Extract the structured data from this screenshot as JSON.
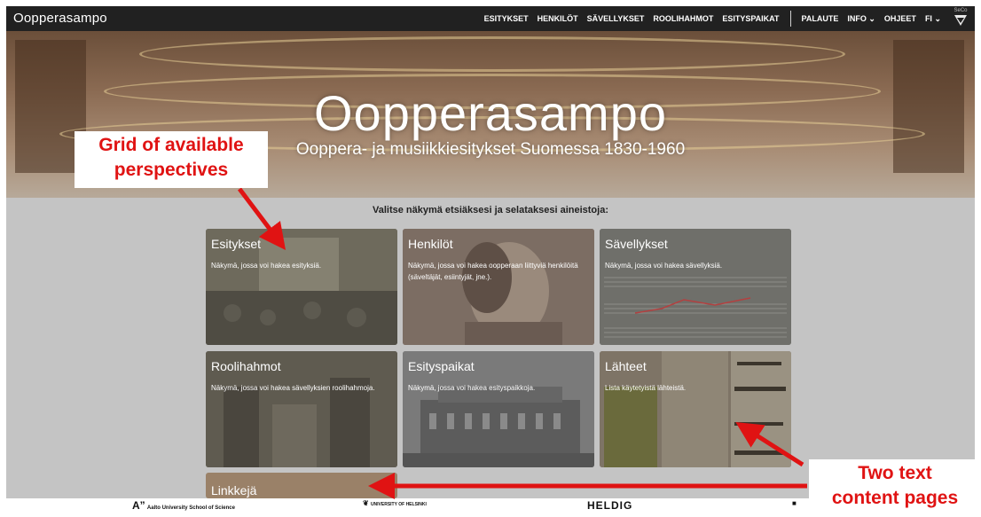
{
  "app": {
    "brand": "Oopperasampo"
  },
  "nav": {
    "items": [
      "ESITYKSET",
      "HENKILÖT",
      "SÄVELLYKSET",
      "ROOLIHAHMOT",
      "ESITYSPAIKAT"
    ],
    "right": [
      "PALAUTE",
      "INFO",
      "OHJEET",
      "FI"
    ],
    "logo_text": "SeCo"
  },
  "hero": {
    "title": "Oopperasampo",
    "subtitle": "Ooppera- ja musiikkiesitykset Suomessa 1830-1960"
  },
  "prompt": "Valitse näkymä etsiäksesi ja selataksesi aineistoja:",
  "cards": [
    {
      "title": "Esitykset",
      "desc": "Näkymä, jossa voi hakea esityksiä."
    },
    {
      "title": "Henkilöt",
      "desc": "Näkymä, jossa voi hakea oopperaan liittyviä henkilöitä (säveltäjät, esiintyjät, jne.)."
    },
    {
      "title": "Sävellykset",
      "desc": "Näkymä, jossa voi hakea sävellyksiä."
    },
    {
      "title": "Roolihahmot",
      "desc": "Näkymä, jossa voi hakea sävellyksien roolihahmoja."
    },
    {
      "title": "Esityspaikat",
      "desc": "Näkymä, jossa voi hakea esityspaikkoja."
    },
    {
      "title": "Lähteet",
      "desc": "Lista käytetyistä lähteistä."
    },
    {
      "title": "Linkkejä",
      "desc": ""
    }
  ],
  "footer": {
    "aalto": "Aalto University School of Science",
    "helsinki": "UNIVERSITY OF HELSINKI",
    "heldig": "HELDIG"
  },
  "annotations": {
    "grid_callout_line1": "Grid of available",
    "grid_callout_line2": "perspectives",
    "content_callout_line1": "Two text",
    "content_callout_line2": "content pages",
    "color": "#e01313"
  },
  "colors": {
    "appbar": "#212121",
    "overlay": "#c4c4c4",
    "accent": "#e01313"
  }
}
